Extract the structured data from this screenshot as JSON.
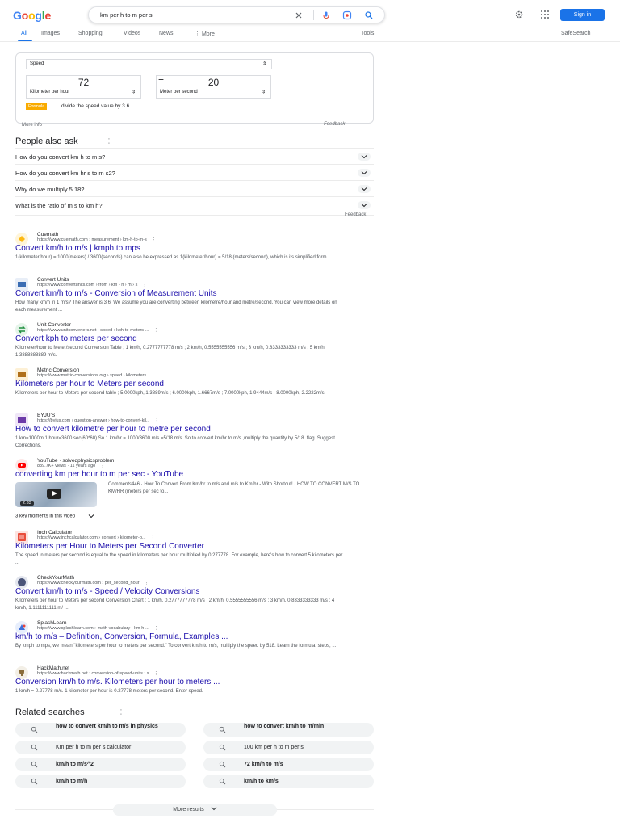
{
  "header": {
    "logo": "Google",
    "query": "km per h to m per s",
    "signin": "Sign in"
  },
  "tabs": [
    {
      "label": "All"
    },
    {
      "label": "Images"
    },
    {
      "label": "Shopping"
    },
    {
      "label": "Videos"
    },
    {
      "label": "News"
    },
    {
      "label": "More"
    }
  ],
  "tools_label": "Tools",
  "safesearch_label": "SafeSearch",
  "converter": {
    "category": "Speed",
    "from_value": "72",
    "to_value": "20",
    "from_unit": "Kilometer per hour",
    "to_unit": "Meter per second",
    "formula_badge": "Formula",
    "formula_text": "divide the speed value by 3.6",
    "more_info": "More info",
    "feedback": "Feedback"
  },
  "paa": {
    "title": "People also ask",
    "questions": [
      "How do you convert km h to m s?",
      "How do you convert km hr s to m s2?",
      "Why do we multiply 5 18?",
      "What is the ratio of m s to km h?"
    ],
    "feedback": "Feedback"
  },
  "results": [
    {
      "site": "Cuemath",
      "url": "https://www.cuemath.com › measurement › km-h-to-m-s",
      "title": "Convert km/h to m/s | kmph to mps",
      "snippet": "1(kilometer/hour) = 1000(meters) / 3600(seconds) can also be expressed as 1(kilometer/hour) = 5/18 (meters/second), which is its simplified form."
    },
    {
      "site": "Convert Units",
      "url": "https://www.convertunits.com › from › km › h › m › s",
      "title": "Convert km/h to m/s - Conversion of Measurement Units",
      "snippet": "How many km/h in 1 m/s? The answer is 3.6. We assume you are converting between kilometre/hour and metre/second. You can view more details on each measurement ..."
    },
    {
      "site": "Unit Converter",
      "url": "https://www.unitconverters.net › speed › kph-to-meters-...",
      "title": "Convert kph to meters per second",
      "snippet": "Kilometer/hour to Meter/second Conversion Table ; 1 km/h, 0.2777777778 m/s ; 2 km/h, 0.5555555556 m/s ; 3 km/h, 0.8333333333 m/s ; 5 km/h, 1.3888888889 m/s."
    },
    {
      "site": "Metric Conversion",
      "url": "https://www.metric-conversions.org › speed › kilometers...",
      "title": "Kilometers per hour to Meters per second",
      "snippet": "Kilometers per hour to Meters per second table ; 5.0000kph, 1.3889m/s ; 6.0000kph, 1.6667m/s ; 7.0000kph, 1.9444m/s ; 8.0000kph, 2.2222m/s."
    },
    {
      "site": "BYJU'S",
      "url": "https://byjus.com › question-answer › how-to-convert-kil...",
      "title": "How to convert kilometre per hour to metre per second",
      "snippet": "1 km=1000m 1 hour=3600 sec(60*60) So 1 km/hr = 1000/3600 m/s =5/18 m/s. So to convert km/hr to m/s ,multiply the quantity by 5/18. flag. Suggest Corrections."
    }
  ],
  "video": {
    "site": "YouTube · solvedphysicsproblem",
    "meta": "839.7K+ views · 11 years ago",
    "title": "converting km per hour to m per sec - YouTube",
    "snippet": "Comments446 · How To Convert From Km/hr to m/s and m/s to Km/hr - With Shortcut! · HOW TO CONVERT M/S TO KM/HR (meters per sec to...",
    "duration": "2:33",
    "key_moments": "3 key moments in this video"
  },
  "results2": [
    {
      "site": "Inch Calculator",
      "url": "https://www.inchcalculator.com › convert › kilometer-p...",
      "title": "Kilometers per Hour to Meters per Second Converter",
      "snippet": "The speed in meters per second is equal to the speed in kilometers per hour multiplied by 0.277778. For example, here's how to convert 5 kilometers per ..."
    },
    {
      "site": "CheckYourMath",
      "url": "https://www.checkyourmath.com › per_second_hour",
      "title": "Convert km/h to m/s - Speed / Velocity Conversions",
      "snippet": "Kilometers per hour to Meters per second Conversion Chart ; 1 km/h, 0.2777777778 m/s ; 2 km/h, 0.5555555556 m/s ; 3 km/h, 0.8333333333 m/s ; 4 km/h, 1.1111111111 m/ ..."
    },
    {
      "site": "SplashLearn",
      "url": "https://www.splashlearn.com › math-vocabulary › km-h-...",
      "title": "km/h to m/s – Definition, Conversion, Formula, Examples ...",
      "snippet": "By kmph to mps, we mean \"kilometers per hour to meters per second.\" To convert km/h to m/s, multiply the speed by 518. Learn the formula, steps, ..."
    },
    {
      "site": "HackMath.net",
      "url": "https://www.hackmath.net › conversion-of-speed-units › s",
      "title": "Conversion km/h to m/s. Kilometers per hour to meters ...",
      "snippet": "1 km/h = 0.27778 m/s. 1 kilometer per hour is 0.27778 meters per second. Enter speed."
    }
  ],
  "related": {
    "title": "Related searches",
    "items": [
      "how to convert km/h to m/s in physics",
      "how to convert km/h to m/min",
      "Km per h to m per s calculator",
      "100 km per h to m per s",
      "km/h to m/s^2",
      "72 km/h to m/s",
      "km/h to m/h",
      "km/h to km/s"
    ]
  },
  "more_results": "More results",
  "colors": {
    "link": "#1a0dab",
    "accent": "#1a73e8",
    "formula": "#f9ab00"
  }
}
